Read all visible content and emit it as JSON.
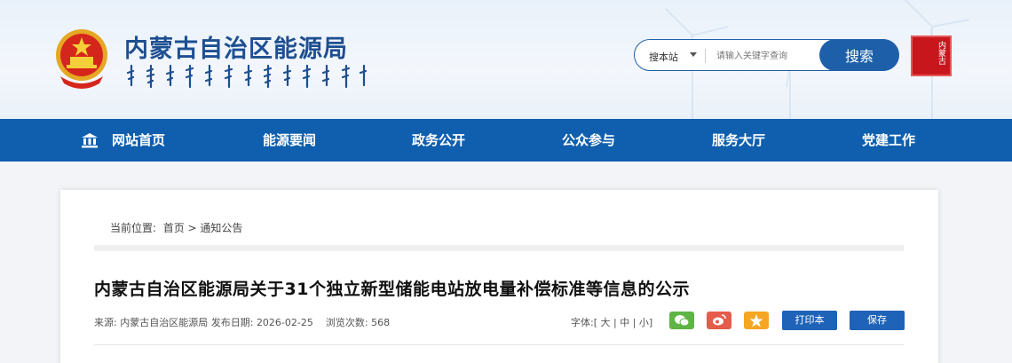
{
  "header": {
    "site_title": "内蒙古自治区能源局",
    "search_scope": "搜本站",
    "search_placeholder": "请输入关键字查询",
    "search_button": "搜索",
    "seal_text": "内蒙古"
  },
  "nav": {
    "items": [
      "网站首页",
      "能源要闻",
      "政务公开",
      "公众参与",
      "服务大厅",
      "党建工作"
    ]
  },
  "breadcrumb": {
    "label": "当前位置:",
    "home": "首页",
    "separator": ">",
    "current": "通知公告"
  },
  "article": {
    "title": "内蒙古自治区能源局关于31个独立新型储能电站放电量补偿标准等信息的公示",
    "source_label": "来源:",
    "source": "内蒙古自治区能源局",
    "date_label": "发布日期:",
    "date": "2026-02-25",
    "views_label": "浏览次数:",
    "views": "568",
    "font_label": "字体:",
    "font_large": "大",
    "font_medium": "中",
    "font_small": "小",
    "print_button": "打印本页",
    "save_button": "保存"
  },
  "colors": {
    "nav_bg": "#0f5fae",
    "brand_blue": "#1d4f91",
    "search_blue": "#1d5fa8",
    "seal_red": "#c8161d",
    "wechat_green": "#5fb446",
    "weibo_red": "#e55b4c",
    "fav_orange": "#f5a623"
  },
  "icons": {
    "emblem": "national-emblem-icon",
    "home": "home-icon",
    "wechat": "wechat-icon",
    "weibo": "weibo-icon",
    "favorite": "star-icon"
  }
}
